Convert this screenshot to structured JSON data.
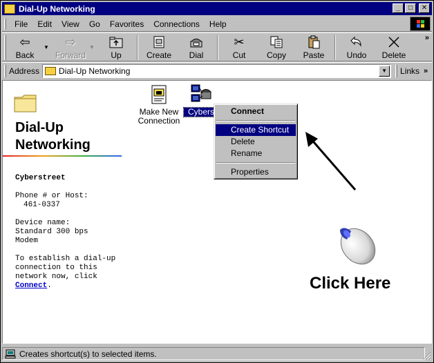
{
  "window": {
    "title": "Dial-Up Networking"
  },
  "menu": {
    "items": [
      "File",
      "Edit",
      "View",
      "Go",
      "Favorites",
      "Connections",
      "Help"
    ]
  },
  "toolbar": {
    "back": "Back",
    "forward": "Forward",
    "up": "Up",
    "create": "Create",
    "dial": "Dial",
    "cut": "Cut",
    "copy": "Copy",
    "paste": "Paste",
    "undo": "Undo",
    "delete": "Delete",
    "more": "»"
  },
  "address": {
    "label": "Address",
    "value": "Dial-Up Networking",
    "links": "Links",
    "links_more": "»"
  },
  "panel": {
    "title_line1": "Dial-Up",
    "title_line2": "Networking",
    "connection_name": "Cyberstreet",
    "phone_label": "Phone # or Host:",
    "phone_value": "461-0337",
    "device_label": "Device name:",
    "device_line1": "Standard 300 bps",
    "device_line2": "Modem",
    "help_line1": "To establish a dial-up",
    "help_line2": "connection to this",
    "help_line3": "network now, click",
    "help_link": "Connect",
    "help_period": "."
  },
  "icons": {
    "make_new_line1": "Make New",
    "make_new_line2": "Connection",
    "cyberstreet_cut": "Cybers"
  },
  "context_menu": {
    "connect": "Connect",
    "create_shortcut": "Create Shortcut",
    "delete": "Delete",
    "rename": "Rename",
    "properties": "Properties"
  },
  "callout": {
    "text": "Click Here"
  },
  "status": {
    "text": "Creates shortcut(s) to selected items."
  },
  "colors": {
    "titlebar": "#000080",
    "face": "#c0c0c0",
    "highlight": "#000080",
    "link": "#0000cc"
  }
}
